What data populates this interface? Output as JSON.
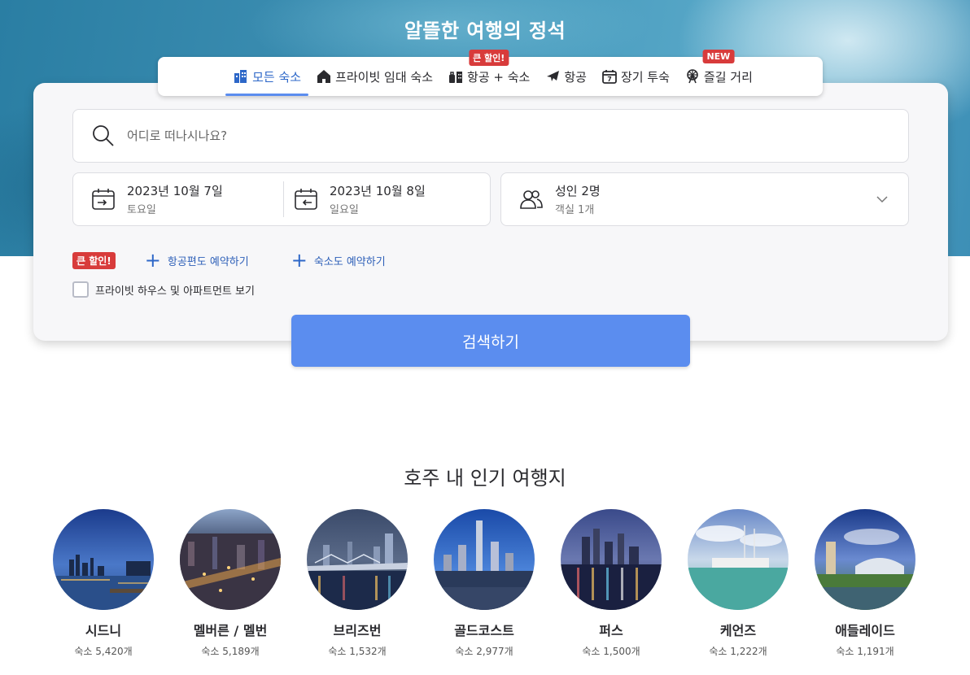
{
  "hero": {
    "title": "알뜰한 여행의 정석"
  },
  "tabs": [
    {
      "label": "모든 숙소",
      "icon": "buildings-icon",
      "active": true,
      "badge": ""
    },
    {
      "label": "프라이빗 임대 숙소",
      "icon": "house-icon",
      "active": false,
      "badge": ""
    },
    {
      "label": "항공 + 숙소",
      "icon": "luggage-hotel-icon",
      "active": false,
      "badge": "큰 할인!"
    },
    {
      "label": "항공",
      "icon": "airplane-icon",
      "active": false,
      "badge": ""
    },
    {
      "label": "장기 투숙",
      "icon": "calendar-7-icon",
      "active": false,
      "badge": ""
    },
    {
      "label": "즐길 거리",
      "icon": "ferris-wheel-icon",
      "active": false,
      "badge": "NEW"
    }
  ],
  "search": {
    "placeholder": "어디로 떠나시나요?"
  },
  "checkin": {
    "date": "2023년 10월 7일",
    "weekday": "토요일"
  },
  "checkout": {
    "date": "2023년 10월 8일",
    "weekday": "일요일"
  },
  "guests": {
    "main": "성인 2명",
    "sub": "객실 1개"
  },
  "promo": {
    "badge": "큰 할인!",
    "add_flight": "항공편도 예약하기",
    "add_hotel": "숙소도 예약하기"
  },
  "private_option": {
    "label": "프라이빗 하우스 및 아파트먼트 보기",
    "checked": false
  },
  "search_button": "검색하기",
  "section": {
    "title": "호주 내 인기 여행지"
  },
  "destinations": [
    {
      "name": "시드니",
      "count": "숙소 5,420개"
    },
    {
      "name": "멜버른 / 멜번",
      "count": "숙소 5,189개"
    },
    {
      "name": "브리즈번",
      "count": "숙소 1,532개"
    },
    {
      "name": "골드코스트",
      "count": "숙소 2,977개"
    },
    {
      "name": "퍼스",
      "count": "숙소 1,500개"
    },
    {
      "name": "케언즈",
      "count": "숙소 1,222개"
    },
    {
      "name": "애들레이드",
      "count": "숙소 1,191개"
    }
  ],
  "colors": {
    "accent": "#5b8def",
    "badge": "#d83b3b",
    "link": "#2d5fb8"
  }
}
